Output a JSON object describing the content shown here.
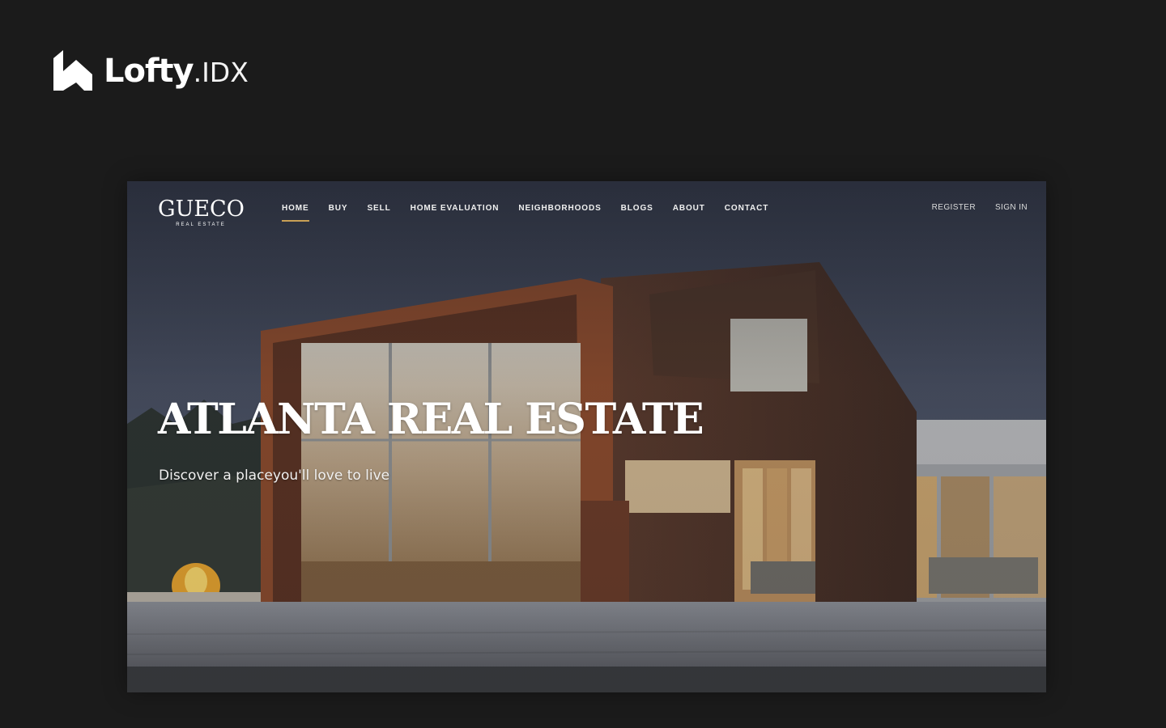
{
  "brand": {
    "name": "Lofty",
    "suffix": ".IDX",
    "icon": "lofty-logo-icon"
  },
  "site": {
    "logo_name": "GUECO",
    "logo_sub": "REAL ESTATE",
    "nav": [
      "HOME",
      "BUY",
      "SELL",
      "HOME EVALUATION",
      "NEIGHBORHOODS",
      "BLOGS",
      "ABOUT",
      "CONTACT"
    ],
    "active_nav": "HOME",
    "register_label": "REGISTER",
    "signin_label": "SIGN IN"
  },
  "hero": {
    "title": "ATLANTA REAL ESTATE",
    "subtitle": "Discover a placeyou'll love to live"
  },
  "colors": {
    "page_bg": "#1b1b1b",
    "accent": "#c9a055",
    "text": "#ffffff"
  }
}
